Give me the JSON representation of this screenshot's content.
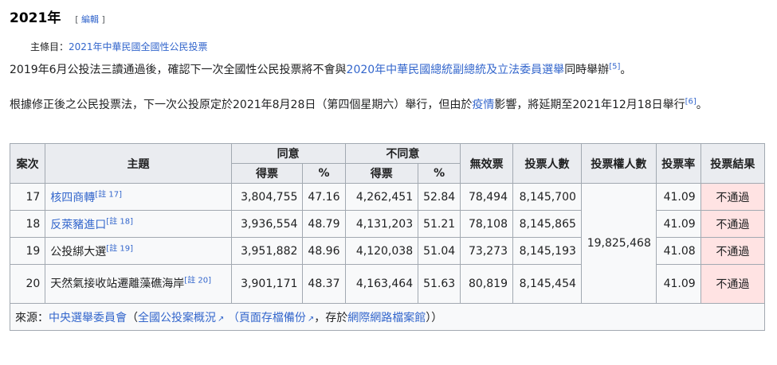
{
  "section": {
    "title": "2021年",
    "edit_open": "[ ",
    "edit_label": "編輯",
    "edit_close": " ]"
  },
  "hatnote": {
    "prefix": "主條目：",
    "link": "2021年中華民國全國性公民投票"
  },
  "para1": {
    "text_a": "2019年6月公投法三讀通過後，確認下一次全國性公民投票將不會與",
    "link": "2020年中華民國總統副總統及立法委員選舉",
    "text_b": "同時舉辦",
    "ref": "[5]",
    "text_c": "。"
  },
  "para2": {
    "text_a": "根據修正後之公民投票法，下一次公投原定於2021年8月28日（第四個星期六）舉行，但由於",
    "link": "疫情",
    "text_b": "影響，將延期至2021年12月18日舉行",
    "ref": "[6]",
    "text_c": "。"
  },
  "table": {
    "headers": {
      "case": "案次",
      "topic": "主題",
      "agree": "同意",
      "disagree": "不同意",
      "invalid": "無效票",
      "votes": "投票人數",
      "electors": "投票權人數",
      "turnout": "投票率",
      "result": "投票結果",
      "count": "得票",
      "pct": "%"
    },
    "shared_electors": "19,825,468",
    "rows": [
      {
        "case": "17",
        "topic": "核四商轉",
        "topic_link": true,
        "note": "[註 17]",
        "agree": "3,804,755",
        "agree_pct": "47.16",
        "disagree": "4,262,451",
        "disagree_pct": "52.84",
        "invalid": "78,494",
        "votes": "8,145,700",
        "turnout": "41.09",
        "result": "不通過"
      },
      {
        "case": "18",
        "topic": "反萊豬進口",
        "topic_link": true,
        "note": "[註 18]",
        "agree": "3,936,554",
        "agree_pct": "48.79",
        "disagree": "4,131,203",
        "disagree_pct": "51.21",
        "invalid": "78,108",
        "votes": "8,145,865",
        "turnout": "41.09",
        "result": "不通過"
      },
      {
        "case": "19",
        "topic": "公投綁大選",
        "topic_link": false,
        "note": "[註 19]",
        "agree": "3,951,882",
        "agree_pct": "48.96",
        "disagree": "4,120,038",
        "disagree_pct": "51.04",
        "invalid": "73,273",
        "votes": "8,145,193",
        "turnout": "41.08",
        "result": "不通過"
      },
      {
        "case": "20",
        "topic": "天然氣接收站遷離藻礁海岸",
        "topic_link": false,
        "note": "[註 20]",
        "agree": "3,901,171",
        "agree_pct": "48.37",
        "disagree": "4,163,464",
        "disagree_pct": "51.63",
        "invalid": "80,819",
        "votes": "8,145,454",
        "turnout": "41.09",
        "result": "不通過"
      }
    ],
    "source": {
      "prefix": "來源：",
      "link1": "中央選舉委員會",
      "open": "（",
      "link2": "全國公投案概況",
      "link3": "（頁面存檔備份",
      "mid": "，存於",
      "link4": "網際網路檔案館",
      "close": "））"
    }
  },
  "colors": {
    "link": "#3366cc",
    "header_bg": "#eaecf0",
    "fail_bg": "#ffe3e3",
    "border": "#a2a9b1"
  }
}
